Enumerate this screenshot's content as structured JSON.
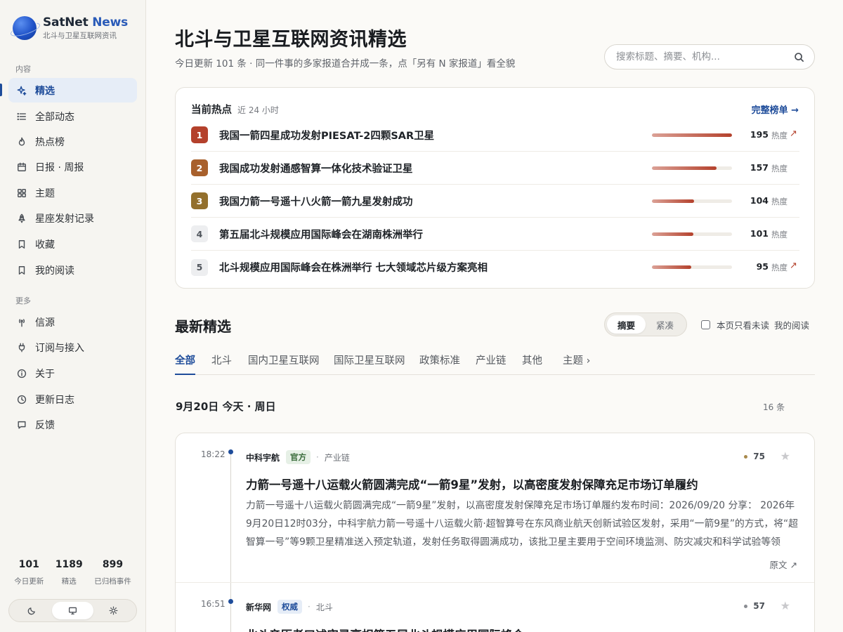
{
  "brand": {
    "name": "SatNet",
    "name_accent": "News",
    "subtitle": "北斗与卫星互联网资讯"
  },
  "sidebar": {
    "section_content": "内容",
    "section_more": "更多",
    "items": [
      {
        "label": "精选",
        "icon": "sparkle-icon"
      },
      {
        "label": "全部动态",
        "icon": "list-icon"
      },
      {
        "label": "热点榜",
        "icon": "flame-icon"
      },
      {
        "label": "日报 · 周报",
        "icon": "calendar-icon"
      },
      {
        "label": "主题",
        "icon": "grid-icon"
      },
      {
        "label": "星座发射记录",
        "icon": "rocket-icon"
      },
      {
        "label": "收藏",
        "icon": "bookmark-icon"
      },
      {
        "label": "我的阅读",
        "icon": "bookmark-icon"
      }
    ],
    "more_items": [
      {
        "label": "信源",
        "icon": "antenna-icon"
      },
      {
        "label": "订阅与接入",
        "icon": "plug-icon"
      },
      {
        "label": "关于",
        "icon": "info-icon"
      },
      {
        "label": "更新日志",
        "icon": "clock-icon"
      },
      {
        "label": "反馈",
        "icon": "message-icon"
      }
    ],
    "stats": [
      {
        "value": "101",
        "label": "今日更新"
      },
      {
        "value": "1189",
        "label": "精选"
      },
      {
        "value": "899",
        "label": "已归档事件"
      }
    ]
  },
  "header": {
    "title": "北斗与卫星互联网资讯精选",
    "subtitle": "今日更新 101 条 · 同一件事的多家报道合并成一条，点「另有 N 家报道」看全貌",
    "search_placeholder": "搜索标题、摘要、机构..."
  },
  "hot": {
    "title": "当前热点",
    "range": "近 24 小时",
    "link": "完整榜单 →",
    "unit": "热度",
    "items": [
      {
        "rank": "1",
        "title": "我国一箭四星成功发射PIESAT-2四颗SAR卫星",
        "score": "195",
        "level": 1.0,
        "trend": "↗",
        "color": "#b4412c"
      },
      {
        "rank": "2",
        "title": "我国成功发射通感智算一体化技术验证卫星",
        "score": "157",
        "level": 0.81,
        "trend": "",
        "color": "#a8602c"
      },
      {
        "rank": "3",
        "title": "我国力箭一号遥十八火箭一箭九星发射成功",
        "score": "104",
        "level": 0.53,
        "trend": "",
        "color": "#93702d"
      },
      {
        "rank": "4",
        "title": "第五届北斗规模应用国际峰会在湖南株洲举行",
        "score": "101",
        "level": 0.52,
        "trend": "",
        "color": ""
      },
      {
        "rank": "5",
        "title": "北斗规模应用国际峰会在株洲举行 七大领域芯片级方案亮相",
        "score": "95",
        "level": 0.49,
        "trend": "↗",
        "color": ""
      }
    ]
  },
  "latest": {
    "title": "最新精选",
    "view_summary": "摘要",
    "view_compact": "紧凑",
    "unread_only": "本页只看未读",
    "my_reading": "我的阅读",
    "tabs": [
      "全部",
      "北斗",
      "国内卫星互联网",
      "国际卫星互联网",
      "政策标准",
      "产业链",
      "其他",
      "主题 ›"
    ],
    "day": "9月20日 今天 · 周日",
    "day_count": "16 条",
    "items": [
      {
        "time": "18:22",
        "source": "中科宇航",
        "badge": "官方",
        "category": "产业链",
        "score": "75",
        "star": "★",
        "title": "力箭一号遥十八运载火箭圆满完成“一箭9星”发射，以高密度发射保障充足市场订单履约",
        "summary": "力箭一号遥十八运载火箭圆满完成“一箭9星”发射，以高密度发射保障充足市场订单履约发布时间：2026/09/20 分享： 2026年9月20日12时03分，中科宇航力箭一号遥十八运载火箭·超智算号在东风商业航天创新试验区发射，采用“一箭9星”的方式，将“超智算一号”等9颗卫星精准送入预定轨道，发射任务取得圆满成功，该批卫星主要用于空间环境监测、防灾减灾和科学试验等领域。",
        "origin": "原文 ↗"
      },
      {
        "time": "16:51",
        "source": "新华网",
        "badge": "权威",
        "category": "北斗",
        "score": "57",
        "star": "★",
        "title": "北斗亲历者口述实录亮相第五届北斗规模应用国际峰会"
      }
    ]
  }
}
